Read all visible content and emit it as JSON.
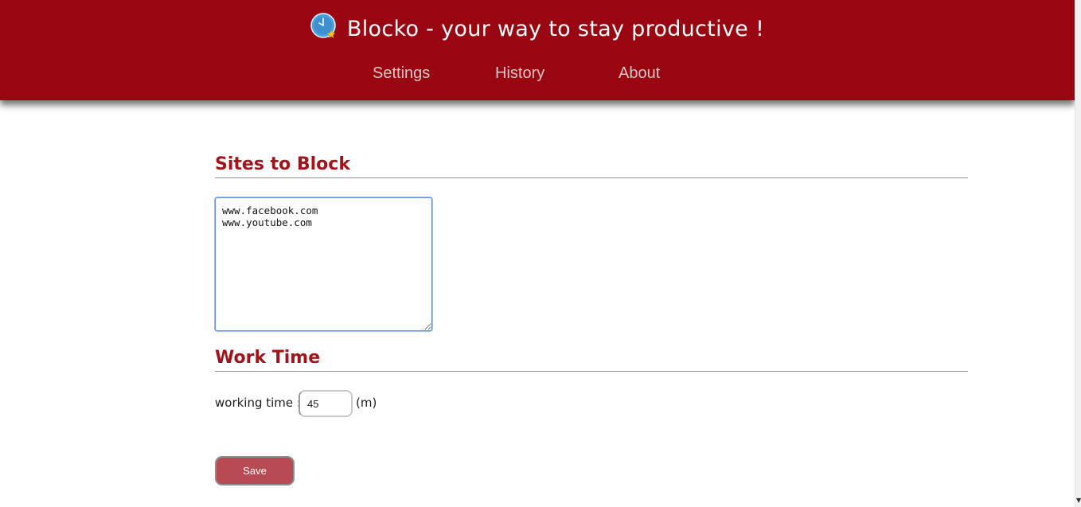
{
  "header": {
    "title": "Blocko - your way to stay productive !",
    "logo_icon": "clock-star-icon",
    "background_color": "#990510"
  },
  "nav": {
    "items": [
      {
        "label": "Settings"
      },
      {
        "label": "History"
      },
      {
        "label": "About"
      }
    ]
  },
  "sites_section": {
    "title": "Sites to Block",
    "textarea_value": "www.facebook.com\nwww.youtube.com"
  },
  "work_section": {
    "title": "Work Time",
    "label": "working time :",
    "value": "45",
    "unit": "(m)"
  },
  "save_button": {
    "label": "Save",
    "color": "#b74a52"
  }
}
